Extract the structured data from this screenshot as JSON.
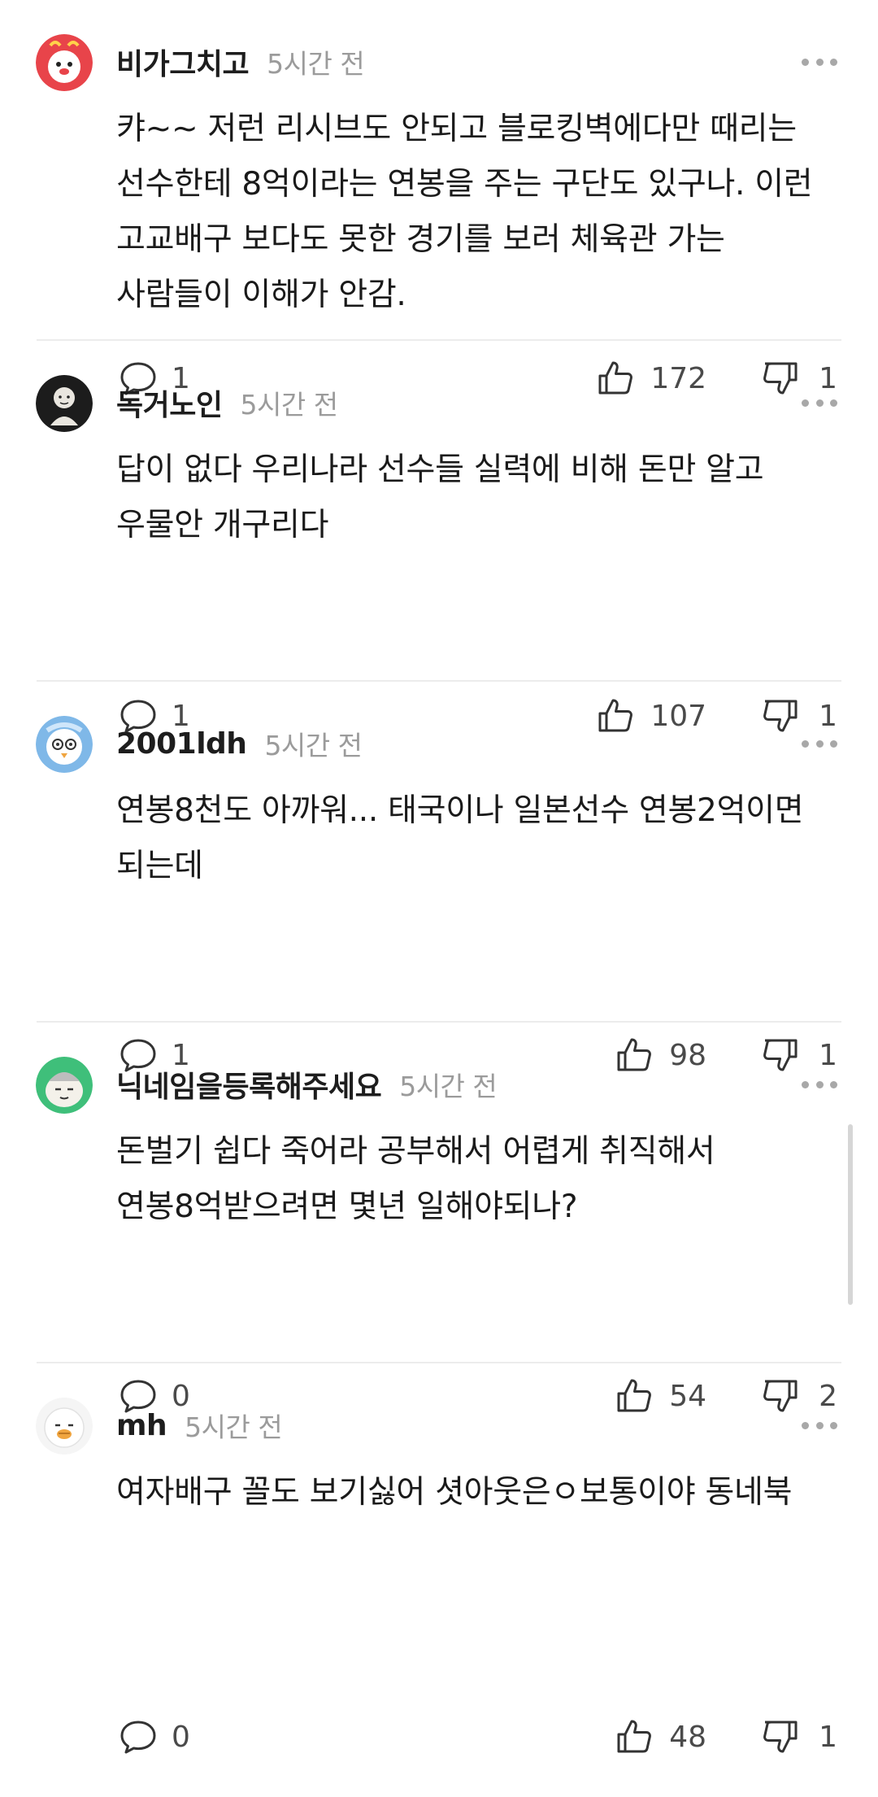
{
  "comments": [
    {
      "username": "비가그치고",
      "time": "5시간 전",
      "text": "캬~~ 저런 리시브도 안되고 블로킹벽에다만 때리는 선수한테 8억이라는 연봉을 주는 구단도 있구나. 이런 고교배구 보다도 못한 경기를 보러 체육관 가는 사람들이 이해가 안감.",
      "replies": "1",
      "likes": "172",
      "dislikes": "1",
      "avatar_color": "#e8444a"
    },
    {
      "username": "독거노인",
      "time": "5시간 전",
      "text": "답이 없다 우리나라 선수들 실력에 비해 돈만 알고 우물안 개구리다",
      "replies": "1",
      "likes": "107",
      "dislikes": "1",
      "avatar_color": "#1c1c1c"
    },
    {
      "username": "2001ldh",
      "time": "5시간 전",
      "text": "연봉8천도 아까워... 태국이나 일본선수 연봉2억이면 되는데",
      "replies": "1",
      "likes": "98",
      "dislikes": "1",
      "avatar_color": "#7fb8e8"
    },
    {
      "username": "닉네임을등록해주세요",
      "time": "5시간 전",
      "text": "돈벌기 쉽다 죽어라 공부해서 어렵게 취직해서 연봉8억받으려면 몇년 일해야되나?",
      "replies": "0",
      "likes": "54",
      "dislikes": "2",
      "avatar_color": "#3fbf7a"
    },
    {
      "username": "mh",
      "time": "5시간 전",
      "text": "여자배구 꼴도 보기싫어 셧아웃은ㅇ보통이야 동네북",
      "replies": "0",
      "likes": "48",
      "dislikes": "1",
      "avatar_color": "#f5f5f5"
    }
  ],
  "icons": {
    "reply": "speech-bubble-icon",
    "like": "thumbs-up-icon",
    "dislike": "thumbs-down-icon",
    "more": "more-dots-icon"
  }
}
